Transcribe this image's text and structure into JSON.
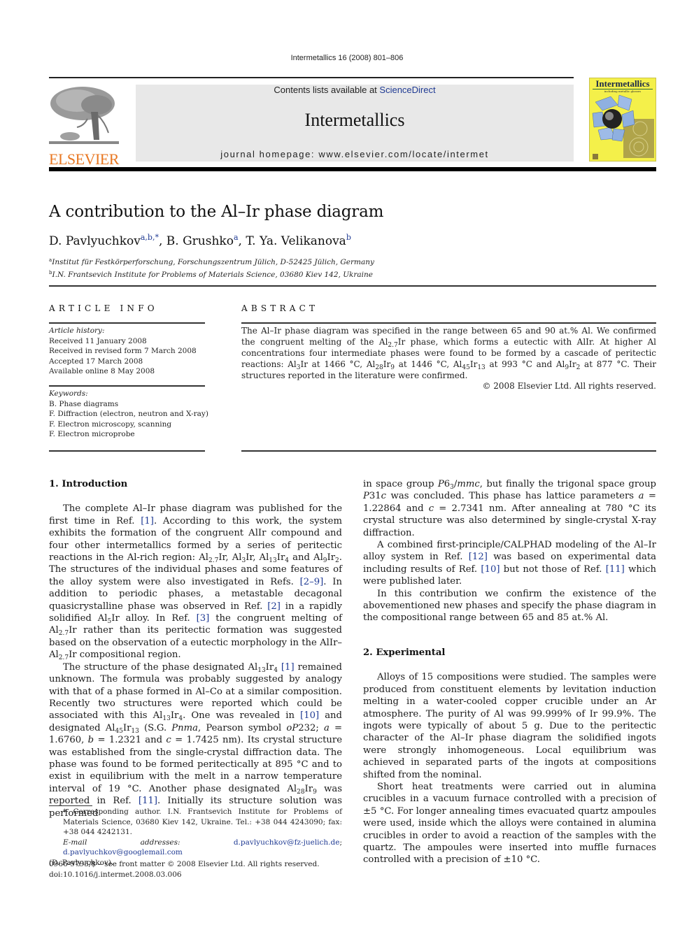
{
  "header": {
    "running_head": "Intermetallics 16 (2008) 801–806",
    "publisher_logo_text": "ELSEVIER",
    "contents_prefix": "Contents lists available at ",
    "contents_link": "ScienceDirect",
    "journal_title": "Intermetallics",
    "homepage_prefix": "journal homepage: ",
    "homepage_url": "www.elsevier.com/locate/intermet",
    "cover_title": "Intermetallics",
    "cover_subtitle": "including metallic glasses",
    "colors": {
      "publisher_orange": "#e87722",
      "link_blue": "#1f3a93",
      "cover_yellow": "#f4f04a",
      "masthead_gray": "#e8e8e8"
    }
  },
  "article": {
    "title": "A contribution to the Al–Ir phase diagram",
    "authors": [
      {
        "name": "D. Pavlyuchkov",
        "marks": "a,b,*"
      },
      {
        "name": "B. Grushko",
        "marks": "a"
      },
      {
        "name": "T. Ya. Velikanova",
        "marks": "b"
      }
    ],
    "affiliations": [
      {
        "mark": "a",
        "text": "Institut für Festkörperforschung, Forschungszentrum Jülich, D-52425 Jülich, Germany"
      },
      {
        "mark": "b",
        "text": "I.N. Frantsevich Institute for Problems of Materials Science, 03680 Kiev 142, Ukraine"
      }
    ]
  },
  "article_info": {
    "heading": "ARTICLE INFO",
    "history_label": "Article history:",
    "history": [
      "Received 11 January 2008",
      "Received in revised form 7 March 2008",
      "Accepted 17 March 2008",
      "Available online 8 May 2008"
    ],
    "keywords_label": "Keywords:",
    "keywords": [
      "B. Phase diagrams",
      "F. Diffraction (electron, neutron and X-ray)",
      "F. Electron microscopy, scanning",
      "F. Electron microprobe"
    ]
  },
  "abstract": {
    "heading": "ABSTRACT",
    "copyright": "© 2008 Elsevier Ltd. All rights reserved."
  },
  "sections": {
    "intro_heading": "1.  Introduction",
    "experimental_heading": "2.  Experimental"
  },
  "references": {
    "r1": "[1]",
    "r2_9": "[2–9]",
    "r2": "[2]",
    "r3": "[3]",
    "r10": "[10]",
    "r11": "[11]",
    "r12": "[12]"
  },
  "footnote": {
    "corresponding": "* Corresponding author. I.N. Frantsevich Institute for Problems of Materials Science, 03680 Kiev 142, Ukraine. Tel.: +38 044 4243090; fax: +38 044 4242131.",
    "email_label": "E-mail addresses:",
    "email_1": "d.pavlyuchkov@fz-juelich.de",
    "email_2": "d.pavlyuchkov@googlemail.com",
    "email_owner": "(D. Pavlyuchkov).",
    "issn": "0966-9795/$ – see front matter © 2008 Elsevier Ltd. All rights reserved.",
    "doi": "doi:10.1016/j.intermet.2008.03.006"
  }
}
